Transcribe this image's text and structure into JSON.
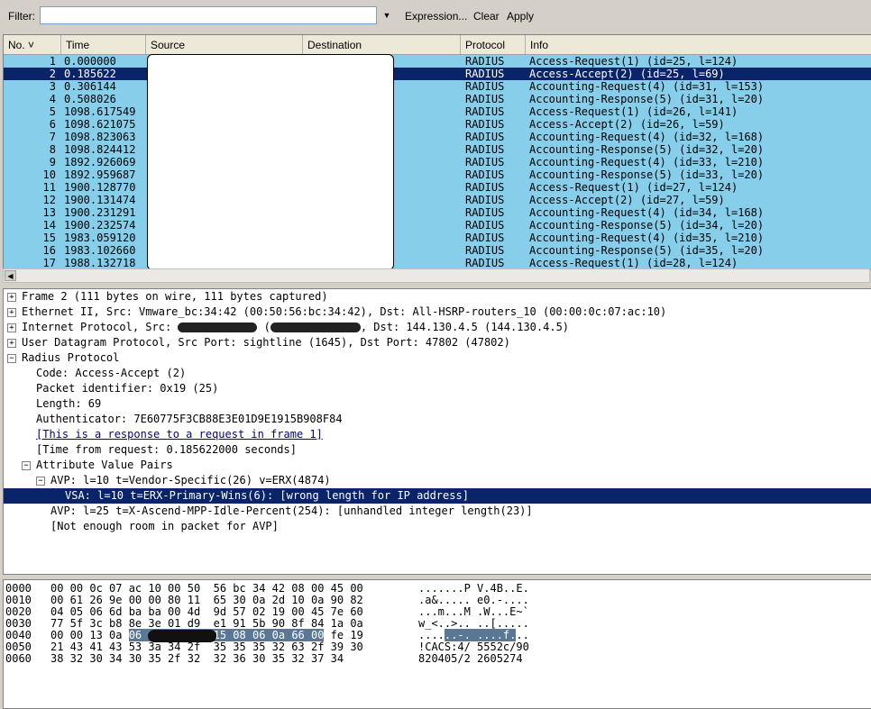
{
  "filter": {
    "label": "Filter:",
    "value": "",
    "expression": "Expression...",
    "clear": "Clear",
    "apply": "Apply"
  },
  "columns": [
    "No. ˅",
    "Time",
    "Source",
    "Destination",
    "Protocol",
    "Info"
  ],
  "packets": [
    {
      "no": "1",
      "time": "0.000000",
      "protocol": "RADIUS",
      "info": "Access-Request(1) (id=25, l=124)"
    },
    {
      "no": "2",
      "time": "0.185622",
      "protocol": "RADIUS",
      "info": "Access-Accept(2) (id=25, l=69)"
    },
    {
      "no": "3",
      "time": "0.306144",
      "protocol": "RADIUS",
      "info": "Accounting-Request(4) (id=31, l=153)"
    },
    {
      "no": "4",
      "time": "0.508026",
      "protocol": "RADIUS",
      "info": "Accounting-Response(5) (id=31, l=20)"
    },
    {
      "no": "5",
      "time": "1098.617549",
      "protocol": "RADIUS",
      "info": "Access-Request(1) (id=26, l=141)"
    },
    {
      "no": "6",
      "time": "1098.621075",
      "protocol": "RADIUS",
      "info": "Access-Accept(2) (id=26, l=59)"
    },
    {
      "no": "7",
      "time": "1098.823063",
      "protocol": "RADIUS",
      "info": "Accounting-Request(4) (id=32, l=168)"
    },
    {
      "no": "8",
      "time": "1098.824412",
      "protocol": "RADIUS",
      "info": "Accounting-Response(5) (id=32, l=20)"
    },
    {
      "no": "9",
      "time": "1892.926069",
      "protocol": "RADIUS",
      "info": "Accounting-Request(4) (id=33, l=210)"
    },
    {
      "no": "10",
      "time": "1892.959687",
      "protocol": "RADIUS",
      "info": "Accounting-Response(5) (id=33, l=20)"
    },
    {
      "no": "11",
      "time": "1900.128770",
      "protocol": "RADIUS",
      "info": "Access-Request(1) (id=27, l=124)"
    },
    {
      "no": "12",
      "time": "1900.131474",
      "protocol": "RADIUS",
      "info": "Access-Accept(2) (id=27, l=59)"
    },
    {
      "no": "13",
      "time": "1900.231291",
      "protocol": "RADIUS",
      "info": "Accounting-Request(4) (id=34, l=168)"
    },
    {
      "no": "14",
      "time": "1900.232574",
      "protocol": "RADIUS",
      "info": "Accounting-Response(5) (id=34, l=20)"
    },
    {
      "no": "15",
      "time": "1983.059120",
      "protocol": "RADIUS",
      "info": "Accounting-Request(4) (id=35, l=210)"
    },
    {
      "no": "16",
      "time": "1983.102660",
      "protocol": "RADIUS",
      "info": "Accounting-Response(5) (id=35, l=20)"
    },
    {
      "no": "17",
      "time": "1988.132718",
      "protocol": "RADIUS",
      "info": "Access-Request(1) (id=28, l=124)"
    }
  ],
  "selected_packet": 1,
  "details": [
    {
      "indent": 0,
      "exp": "+",
      "text": "Frame 2 (111 bytes on wire, 111 bytes captured)"
    },
    {
      "indent": 0,
      "exp": "+",
      "text": "Ethernet II, Src: Vmware_bc:34:42 (00:50:56:bc:34:42), Dst: All-HSRP-routers_10 (00:00:0c:07:ac:10)"
    },
    {
      "indent": 0,
      "exp": "+",
      "text": "Internet Protocol, Src: ",
      "redact": true,
      "text2": "  (",
      "text3": ", Dst: 144.130.4.5 (144.130.4.5)"
    },
    {
      "indent": 0,
      "exp": "+",
      "text": "User Datagram Protocol, Src Port: sightline (1645), Dst Port: 47802 (47802)"
    },
    {
      "indent": 0,
      "exp": "−",
      "text": "Radius Protocol"
    },
    {
      "indent": 1,
      "exp": "",
      "text": "Code: Access-Accept (2)"
    },
    {
      "indent": 1,
      "exp": "",
      "text": "Packet identifier: 0x19 (25)"
    },
    {
      "indent": 1,
      "exp": "",
      "text": "Length: 69"
    },
    {
      "indent": 1,
      "exp": "",
      "text": "Authenticator: 7E60775F3CB88E3E01D9E1915B908F84"
    },
    {
      "indent": 1,
      "exp": "",
      "text": "[This is a response to a request in frame 1]",
      "link": true
    },
    {
      "indent": 1,
      "exp": "",
      "text": "[Time from request: 0.185622000 seconds]"
    },
    {
      "indent": 1,
      "exp": "−",
      "text": "Attribute Value Pairs"
    },
    {
      "indent": 2,
      "exp": "−",
      "text": "AVP: l=10  t=Vendor-Specific(26) v=ERX(4874)"
    },
    {
      "indent": 3,
      "exp": "",
      "text": "VSA: l=10 t=ERX-Primary-Wins(6): [wrong length for IP address]",
      "selected": true
    },
    {
      "indent": 2,
      "exp": "",
      "text": "AVP: l=25  t=X-Ascend-MPP-Idle-Percent(254): [unhandled integer length(23)]"
    },
    {
      "indent": 2,
      "exp": "",
      "text": "[Not enough room in packet for AVP]"
    }
  ],
  "hex": [
    {
      "off": "0000",
      "bytes": "00 00 0c 07 ac 10 00 50  56 bc 34 42 08 00 45 00",
      "ascii": ".......P V.4B..E."
    },
    {
      "off": "0010",
      "bytes": "00 61 26 9e 00 00 80 11  65 30 0a 2d 10 0a 90 82",
      "ascii": ".a&..... e0.-...."
    },
    {
      "off": "0020",
      "bytes": "04 05 06 6d ba ba 00 4d  9d 57 02 19 00 45 7e 60",
      "ascii": "...m...M .W...E~`"
    },
    {
      "off": "0030",
      "bytes": "77 5f 3c b8 8e 3e 01 d9  e1 91 5b 90 8f 84 1a 0a",
      "ascii": "w_<..>.. ..[....."
    },
    {
      "off": "0040",
      "bytes_pre": "00 00 13 0a ",
      "bytes_hl": "06 0a ac 10  15 08 06 0a 66 00",
      "bytes_post": " fe 19",
      "ascii_pre": "....",
      "ascii_hl": "..-. ....f.",
      "ascii_post": ".."
    },
    {
      "off": "0050",
      "bytes": "21 43 41 43 53 3a 34 2f  35 35 35 32 63 2f 39 30",
      "ascii": "!CACS:4/ 5552c/90"
    },
    {
      "off": "0060",
      "bytes": "38 32 30 34 30 35 2f 32  32 36 30 35 32 37 34",
      "ascii": "820405/2 2605274"
    }
  ],
  "colors": {
    "row_bg": "#87ceeb",
    "selected_bg": "#0a246a",
    "hex_highlight": "#5a7896"
  }
}
